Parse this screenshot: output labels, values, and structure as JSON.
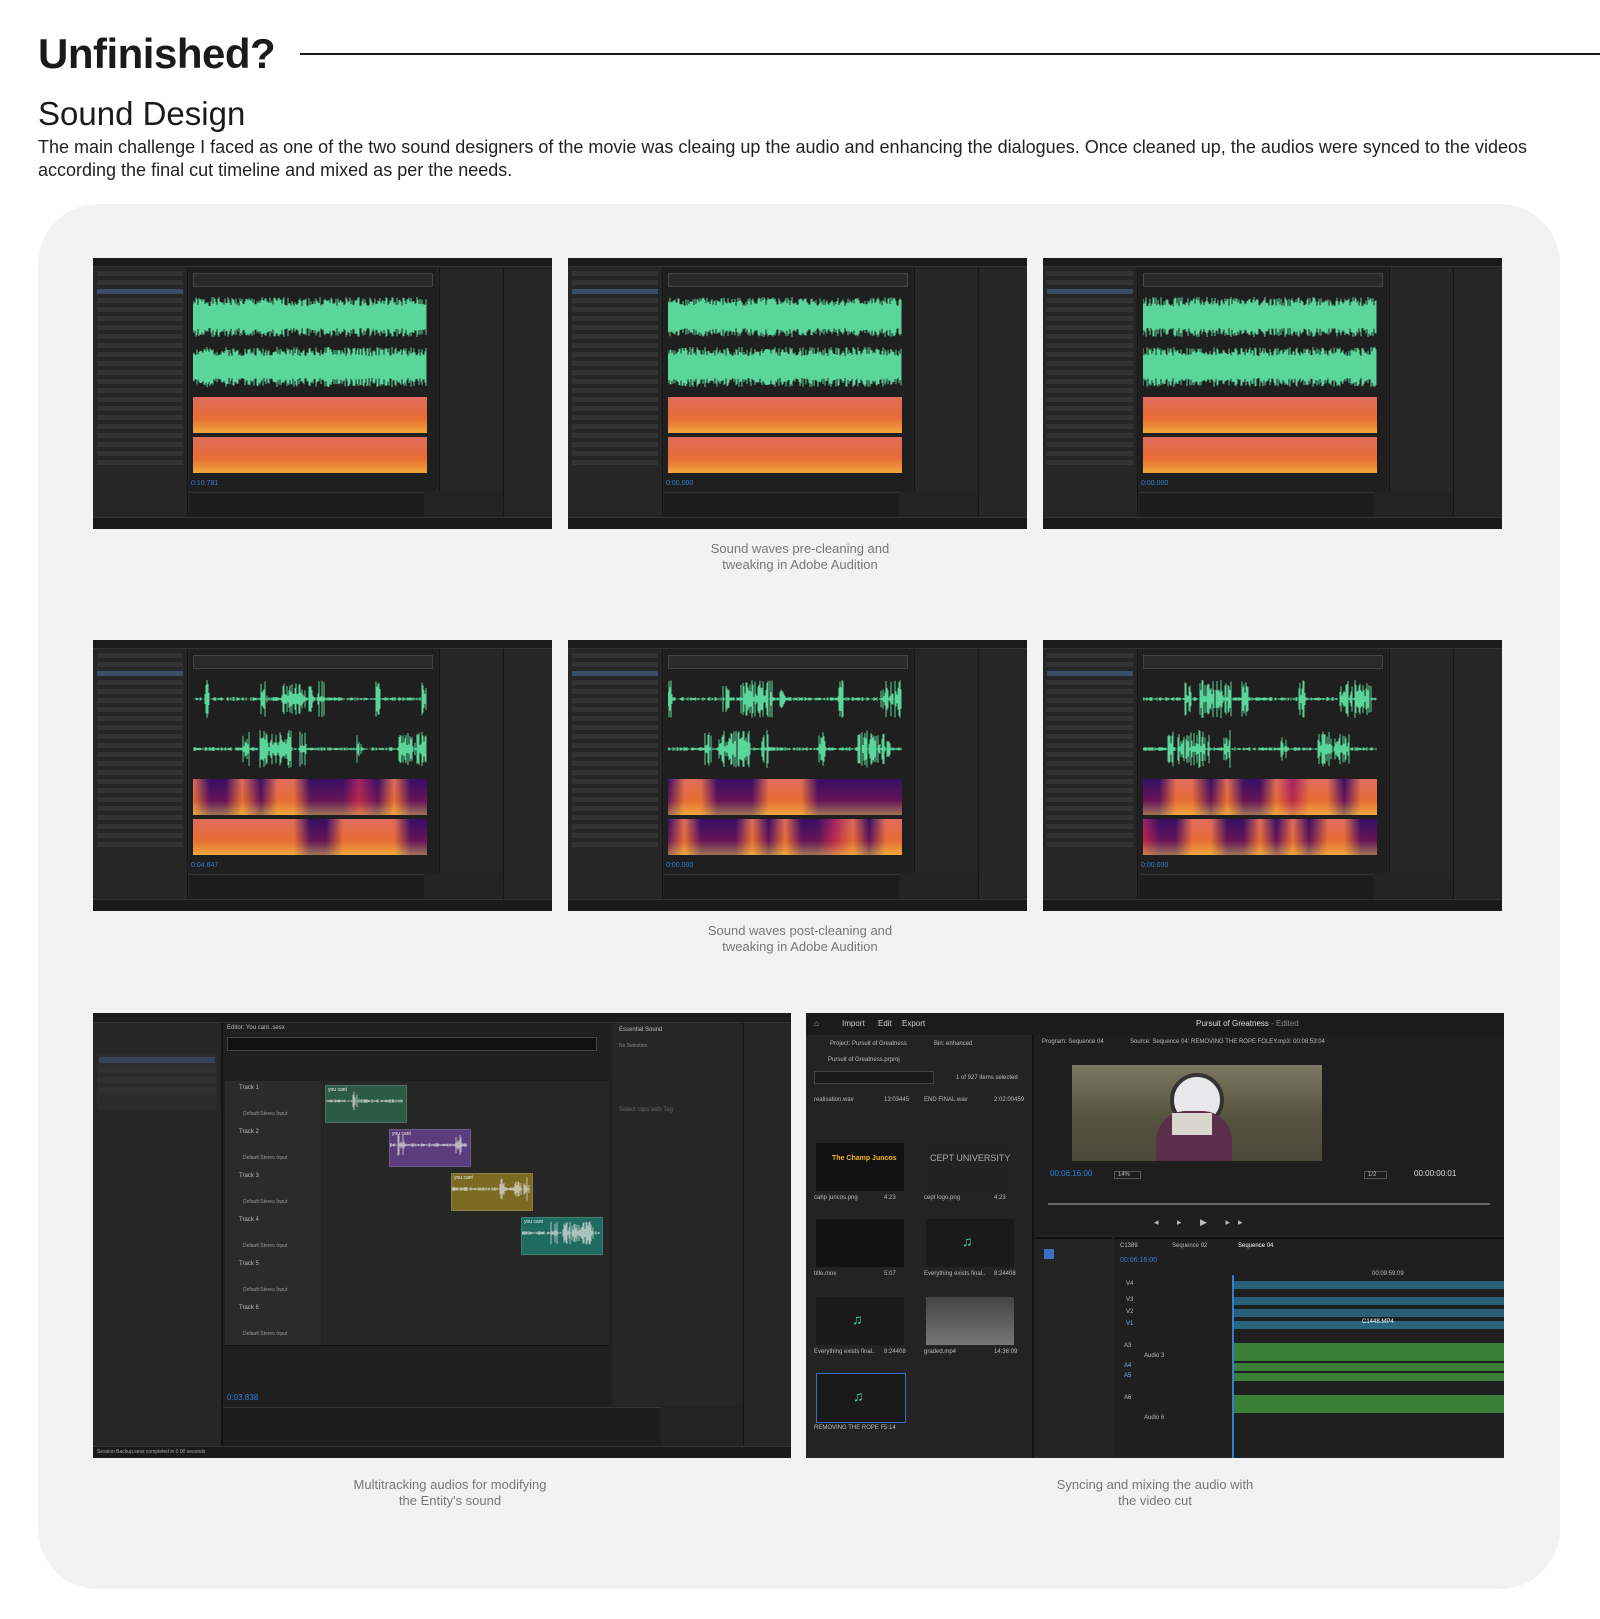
{
  "page": {
    "title": "Unfinished?",
    "section_heading": "Sound Design",
    "intro": "The main challenge I faced as one of the two sound designers of the movie was cleaing up the audio and enhancing the dialogues. Once cleaned up, the audios were synced to the videos according the final cut timeline and mixed as per the needs."
  },
  "captions": {
    "pre_line1": "Sound waves pre-cleaning and",
    "pre_line2": "tweaking in Adobe Audition",
    "post_line1": "Sound waves post-cleaning and",
    "post_line2": "tweaking in Adobe Audition",
    "multi_line1": "Multitracking audios for modifying",
    "multi_line2": "the Entity's sound",
    "sync_line1": "Syncing and mixing the audio with",
    "sync_line2": "the video cut"
  },
  "audition_shots": [
    {
      "time": "0:10.781"
    },
    {
      "time": "0:00.000"
    },
    {
      "time": "0:00.000"
    },
    {
      "time": "0:04.647"
    },
    {
      "time": "0:00.000"
    },
    {
      "time": "0:00.000"
    }
  ],
  "multitrack": {
    "editor_tab": "Editor: You cant .sesx",
    "time": "0:03.838",
    "tracks": [
      "Track 1",
      "Track 2",
      "Track 3",
      "Track 4",
      "Track 5",
      "Track 6"
    ],
    "input": "Default Stereo Input",
    "clip": "you cant",
    "essential_sound": "Essential Sound",
    "no_selection": "No Selection",
    "select_clips": "Select clips with Tag",
    "status": "Session Backup.sesx completed in 0.00 seconds"
  },
  "premiere": {
    "menu": [
      "Import",
      "Edit",
      "Export"
    ],
    "project_title": "Pursuit of Greatness",
    "edited": "- Edited",
    "project_tab": "Project: Pursuit of Greatness",
    "bin": "Bin: enhanced",
    "project_file": "Pursuit of Greatness.prproj",
    "items_selected": "1 of 927 items selected",
    "program_tab": "Program: Sequence 04",
    "source_tab": "Source: Sequence 04: REMOVING THE ROPE FOLEY.mp3: 00:08:53:04",
    "timecode": "00:06:16:00",
    "zoom": "14%",
    "fraction": "1/2",
    "end_timecode": "00:00:00:01",
    "sequence_tabs": [
      "C1389",
      "Sequence 02",
      "Sequence 04"
    ],
    "seq_timecode": "00:06:16:00",
    "ruler_mark": "00:09:59:09",
    "media": [
      {
        "name": "realisation.wav",
        "dur": "13:03445"
      },
      {
        "name": "END FINAL.wav",
        "dur": "2:02:00459"
      },
      {
        "name": "cahp juncos.png",
        "dur": "4:23"
      },
      {
        "name": "cept logo.png",
        "dur": "4:23"
      },
      {
        "name": "title.mov",
        "dur": "5:07"
      },
      {
        "name": "Everything exists final..",
        "dur": "8:24408"
      },
      {
        "name": "Everything exists final..",
        "dur": "8:24408"
      },
      {
        "name": "graded.mp4",
        "dur": "14:36:09"
      },
      {
        "name": "REMOVING THE ROPE F..",
        "dur": "5:14"
      }
    ],
    "tracks": [
      "V4",
      "V3",
      "V2",
      "V1",
      "A3",
      "A4",
      "A5",
      "A6"
    ],
    "audio3": "Audio 3",
    "audio6": "Audio 6",
    "clip_label": "C1448.MP4",
    "logo_text": "CEPT UNIVERSITY",
    "logo_brand": "The Champ Juncos"
  },
  "colors": {
    "wave": "#5bd69a",
    "spectrogram_low": "#3a0e6a",
    "spectrogram_high": "#ffb23a",
    "accent_blue": "#2f7fd6"
  }
}
